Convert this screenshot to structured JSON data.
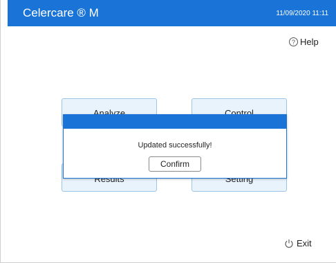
{
  "header": {
    "app_title": "Celercare ® M",
    "datetime": "11/09/2020 11:11"
  },
  "help": {
    "label": "Help",
    "icon": "help-circle-icon"
  },
  "menu": {
    "analyze": "Analyze",
    "control": "Control",
    "results": "Results",
    "setting": "Setting"
  },
  "dialog": {
    "message": "Updated successfully!",
    "confirm_label": "Confirm"
  },
  "exit": {
    "label": "Exit",
    "icon": "power-icon"
  },
  "colors": {
    "accent": "#1a73d6",
    "button_bg": "#e9f3fc",
    "button_border": "#9dc4e4"
  }
}
